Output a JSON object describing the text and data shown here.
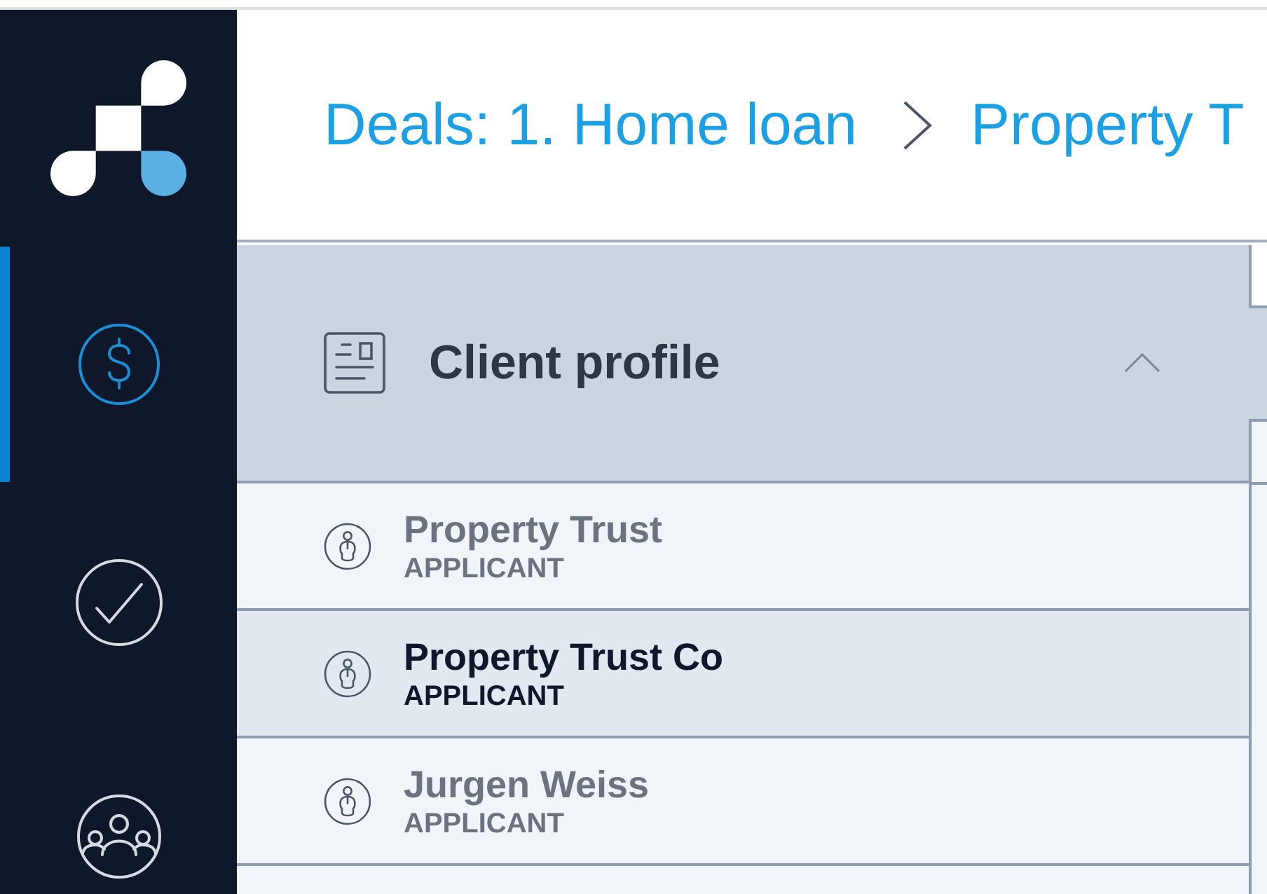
{
  "sidebar": {
    "items": [
      {
        "kind": "dollar",
        "selected": true
      },
      {
        "kind": "check",
        "selected": false
      },
      {
        "kind": "people",
        "selected": false
      }
    ]
  },
  "breadcrumb": [
    "Deals: 1. Home loan",
    "Property T"
  ],
  "section": {
    "title": "Client profile",
    "expanded": true
  },
  "rows": [
    {
      "name": "Property Trust",
      "role": "APPLICANT",
      "selected": false
    },
    {
      "name": "Property Trust Co",
      "role": "APPLICANT",
      "selected": true
    },
    {
      "name": "Jurgen Weiss",
      "role": "APPLICANT",
      "selected": false
    }
  ]
}
